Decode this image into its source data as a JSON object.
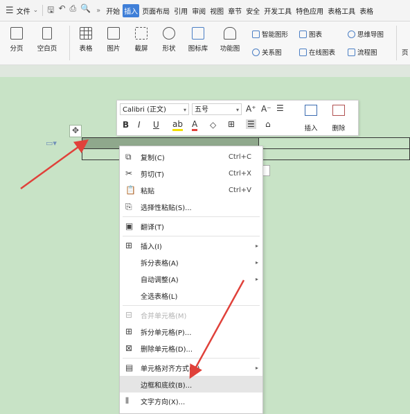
{
  "menubar": {
    "file_label": "文件",
    "more": "»",
    "menus": [
      "开始",
      "插入",
      "页面布局",
      "引用",
      "审阅",
      "视图",
      "章节",
      "安全",
      "开发工具",
      "特色应用",
      "表格工具",
      "表格"
    ],
    "active_menu": "插入"
  },
  "ribbon": {
    "page_break": "分页",
    "blank_page": "空白页",
    "table": "表格",
    "picture": "图片",
    "screenshot": "截屏",
    "shapes": "形状",
    "icon_library": "图标库",
    "function_chart": "功能图",
    "smart_shape": "智能图形",
    "chart": "图表",
    "mind_map": "思维导图",
    "relation_chart": "关系图",
    "online_chart": "在线图表",
    "flowchart": "流程图",
    "more": "页"
  },
  "mini_toolbar": {
    "font": "Calibri (正文)",
    "size": "五号",
    "insert": "插入",
    "delete": "删除"
  },
  "context_menu": {
    "copy": "复制(C)",
    "copy_sc": "Ctrl+C",
    "cut": "剪切(T)",
    "cut_sc": "Ctrl+X",
    "paste": "粘贴",
    "paste_sc": "Ctrl+V",
    "paste_special": "选择性粘贴(S)...",
    "translate": "翻译(T)",
    "insert": "插入(I)",
    "split_table": "拆分表格(A)",
    "autofit": "自动调整(A)",
    "select_table": "全选表格(L)",
    "merge_cells": "合并单元格(M)",
    "split_cells": "拆分单元格(P)...",
    "delete_cells": "删除单元格(D)...",
    "cell_align": "单元格对齐方式(G)",
    "borders": "边框和底纹(B)...",
    "text_direction": "文字方向(X)..."
  },
  "colors": {
    "accent": "#3f7fd8",
    "page_bg": "#c8e3c6",
    "arrow": "#e0413a"
  }
}
